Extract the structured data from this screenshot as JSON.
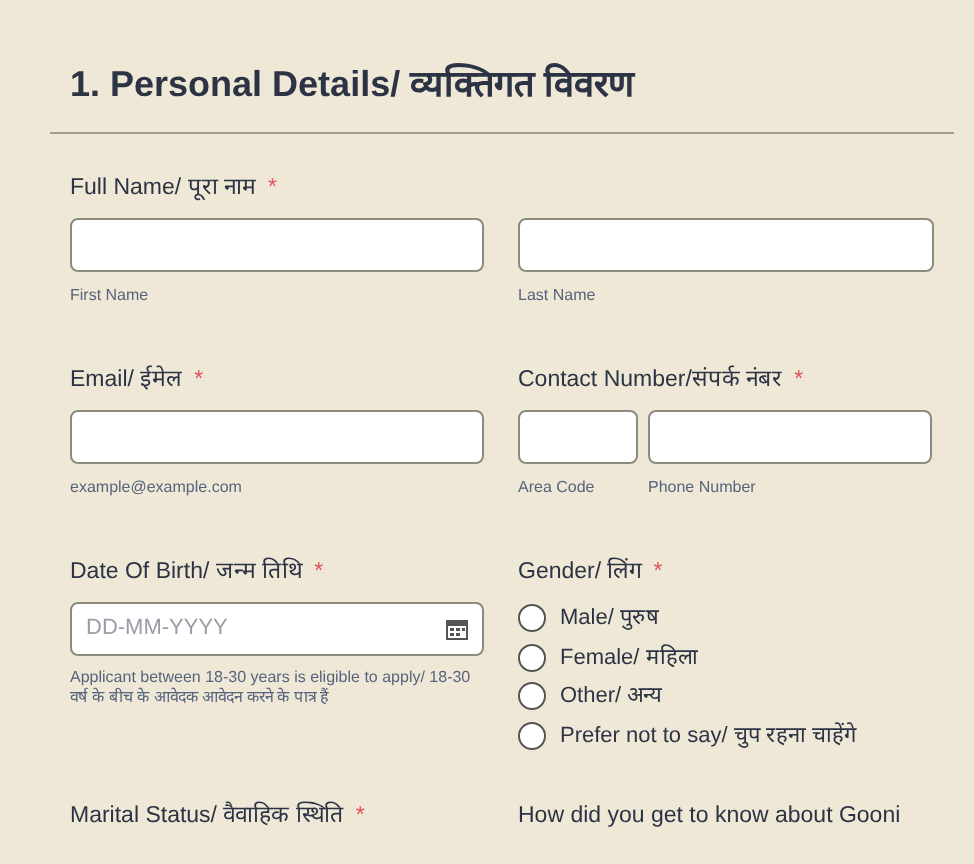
{
  "section_title": "1. Personal Details/ व्यक्तिगत विवरण",
  "rows": [
    {
      "fields": [
        {
          "kind": "name",
          "label": "Full Name/ पूरा नाम",
          "marker": "*",
          "sublabels": [
            "First Name",
            "Last Name"
          ]
        }
      ]
    },
    {
      "fields": [
        {
          "kind": "text",
          "label": "Email/ ईमेल",
          "marker": "*",
          "sublabel": "example@example.com"
        },
        {
          "kind": "phone",
          "label": "Contact Number/संपर्क नंबर",
          "marker": "*",
          "sublabels": [
            "Area Code",
            "Phone Number"
          ]
        }
      ]
    },
    {
      "fields": [
        {
          "kind": "date",
          "label": "Date Of Birth/ जन्म तिथि",
          "marker": "*",
          "placeholder": "DD-MM-YYYY",
          "sublabel": "Applicant between 18-30 years is eligible to apply/ 18-30 वर्ष के बीच के आवेदक आवेदन करने के पात्र हैं"
        },
        {
          "kind": "radio",
          "label": "Gender/ लिंग",
          "marker": "*",
          "options": [
            {
              "label": "Male/ पुरुष",
              "selected": false
            },
            {
              "label": "Female/ महिला",
              "selected": false
            },
            {
              "label": "Other/ अन्य",
              "selected": false
            },
            {
              "label": "Prefer not to say/ चुप रहना चाहेंगे",
              "selected": false
            }
          ]
        }
      ]
    },
    {
      "fields": [
        {
          "kind": "label",
          "label": "Marital Status/ वैवाहिक स्थिति",
          "marker": "*"
        },
        {
          "kind": "label",
          "label": "How did you get to know about Gooni"
        }
      ]
    }
  ]
}
